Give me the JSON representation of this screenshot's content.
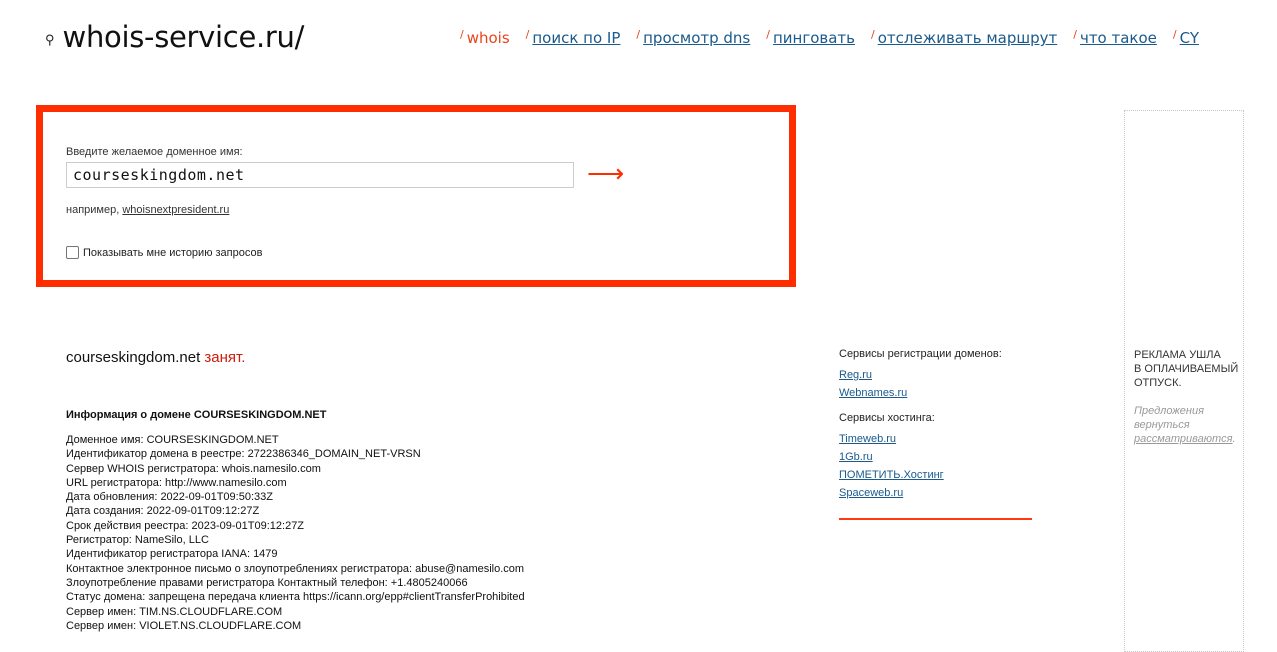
{
  "header": {
    "logo_icon": "search-icon",
    "logo_text": "whois-service.ru/",
    "nav": [
      {
        "label": "whois",
        "active": true
      },
      {
        "label": "поиск по IP",
        "active": false
      },
      {
        "label": "просмотр dns",
        "active": false
      },
      {
        "label": "пинговать",
        "active": false
      },
      {
        "label": "отслеживать маршрут",
        "active": false
      },
      {
        "label": "что такое",
        "active": false
      },
      {
        "label": "CY",
        "active": false
      }
    ]
  },
  "search": {
    "label": "Введите желаемое доменное имя:",
    "value": "courseskingdom.net",
    "submit_icon": "arrow-right-icon",
    "example_prefix": "например,",
    "example_link": "whoisnextpresident.ru",
    "history_label": "Показывать мне историю запросов",
    "history_checked": false
  },
  "result": {
    "domain": "courseskingdom.net",
    "status": "занят.",
    "info_title": "Информация о домене COURSESKINGDOM.NET",
    "info_lines": [
      "Доменное имя: COURSESKINGDOM.NET",
      "Идентификатор домена в реестре: 2722386346_DOMAIN_NET-VRSN",
      "Сервер WHOIS регистратора: whois.namesilo.com",
      "URL регистратора: http://www.namesilo.com",
      "Дата обновления: 2022-09-01T09:50:33Z",
      "Дата создания: 2022-09-01T09:12:27Z",
      "Срок действия реестра: 2023-09-01T09:12:27Z",
      "Регистратор: NameSilo, LLC",
      "Идентификатор регистратора IANA: 1479",
      "Контактное электронное письмо о злоупотреблениях регистратора: abuse@namesilo.com",
      "Злоупотребление правами регистратора Контактный телефон: +1.4805240066",
      "Статус домена: запрещена передача клиента https://icann.org/epp#clientTransferProhibited",
      "Сервер имен: TIM.NS.CLOUDFLARE.COM",
      "Сервер имен: VIOLET.NS.CLOUDFLARE.COM"
    ]
  },
  "services": {
    "registration_title": "Сервисы регистрации доменов:",
    "registration_links": [
      "Reg.ru",
      "Webnames.ru"
    ],
    "hosting_title": "Сервисы хостинга:",
    "hosting_links": [
      "Timeweb.ru",
      "1Gb.ru",
      "ПОМЕТИТЬ.Хостинг",
      "Spaceweb.ru"
    ]
  },
  "ad": {
    "title_lines": [
      "Реклама ушла",
      "в оплачиваемый",
      "отпуск."
    ],
    "note_lines": [
      "Предложения",
      "вернуться"
    ],
    "note_link": "рассматриваются",
    "note_end": "."
  }
}
